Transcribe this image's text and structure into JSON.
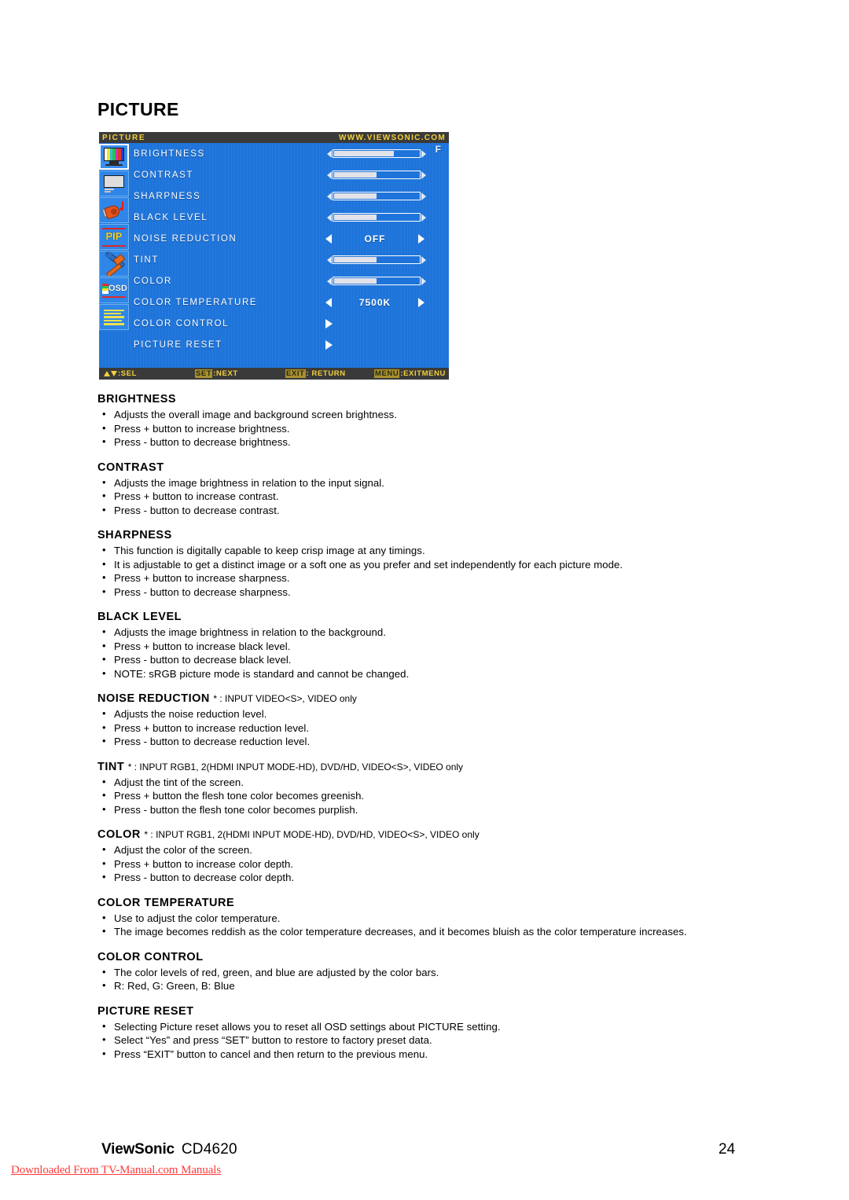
{
  "page": {
    "title": "PICTURE",
    "number": "24"
  },
  "osd": {
    "header_title": "PICTURE",
    "header_url": "WWW.VIEWSONIC.COM",
    "corner_marker": "F",
    "accent_blue": "#1e74da",
    "accent_yellow": "#f3d03a",
    "sidebar_icons": [
      {
        "name": "picture-colorbars-icon",
        "selected": true
      },
      {
        "name": "screen-monitor-icon",
        "selected": false
      },
      {
        "name": "audio-speaker-icon",
        "selected": false
      },
      {
        "name": "pip-icon",
        "label": "PIP",
        "selected": false
      },
      {
        "name": "tools-icon",
        "selected": false
      },
      {
        "name": "osd-icon",
        "label": "OSD",
        "selected": false
      },
      {
        "name": "multi-display-list-icon",
        "selected": false
      }
    ],
    "rows": [
      {
        "label": "BRIGHTNESS",
        "type": "slider",
        "fill": 70
      },
      {
        "label": "CONTRAST",
        "type": "slider",
        "fill": 50
      },
      {
        "label": "SHARPNESS",
        "type": "slider",
        "fill": 50
      },
      {
        "label": "BLACK LEVEL",
        "type": "slider",
        "fill": 50
      },
      {
        "label": "NOISE REDUCTION",
        "type": "option",
        "value": "OFF"
      },
      {
        "label": "TINT",
        "type": "slider",
        "fill": 50
      },
      {
        "label": "COLOR",
        "type": "slider",
        "fill": 50
      },
      {
        "label": "COLOR TEMPERATURE",
        "type": "option",
        "value": "7500K"
      },
      {
        "label": "COLOR CONTROL",
        "type": "submenu"
      },
      {
        "label": "PICTURE RESET",
        "type": "submenu"
      }
    ],
    "footer": [
      {
        "key": "",
        "text": ":SEL",
        "arrows": true
      },
      {
        "key": "SET",
        "text": ":NEXT",
        "arrows": false
      },
      {
        "key": "EXIT",
        "text": ": RETURN",
        "arrows": false
      },
      {
        "key": "MENU",
        "text": ":EXITMENU",
        "arrows": false
      }
    ]
  },
  "sections": [
    {
      "heading": "BRIGHTNESS",
      "note": "",
      "bullets": [
        "Adjusts the overall image and background screen brightness.",
        "Press + button to increase brightness.",
        "Press - button to decrease brightness."
      ]
    },
    {
      "heading": "CONTRAST",
      "note": "",
      "bullets": [
        "Adjusts the image brightness in relation to the input signal.",
        "Press + button to increase contrast.",
        "Press - button to decrease contrast."
      ]
    },
    {
      "heading": "SHARPNESS",
      "note": "",
      "bullets": [
        "This function is digitally capable to keep crisp image at any timings.",
        "It is adjustable to get a distinct image or a soft one as you prefer and set independently for each picture mode.",
        "Press + button to increase sharpness.",
        "Press - button to decrease sharpness."
      ]
    },
    {
      "heading": "BLACK LEVEL",
      "note": "",
      "bullets": [
        "Adjusts the image brightness in relation to the background.",
        "Press + button to increase black level.",
        "Press - button to decrease black level.",
        "NOTE: sRGB picture mode is standard and cannot be changed."
      ]
    },
    {
      "heading": "NOISE REDUCTION",
      "note": "* : INPUT VIDEO<S>, VIDEO only",
      "bullets": [
        "Adjusts the noise reduction level.",
        "Press + button to increase reduction level.",
        "Press - button to decrease reduction level."
      ]
    },
    {
      "heading": "TINT",
      "note": "* : INPUT RGB1, 2(HDMI INPUT MODE-HD), DVD/HD, VIDEO<S>, VIDEO only",
      "bullets": [
        "Adjust the tint of the screen.",
        "Press + button the flesh tone color becomes greenish.",
        "Press - button the flesh tone color becomes purplish."
      ]
    },
    {
      "heading": "COLOR",
      "note": "* : INPUT RGB1, 2(HDMI INPUT MODE-HD), DVD/HD, VIDEO<S>, VIDEO only",
      "bullets": [
        "Adjust the color of the screen.",
        "Press + button to increase color depth.",
        "Press - button to decrease color depth."
      ]
    },
    {
      "heading": "COLOR TEMPERATURE",
      "note": "",
      "bullets": [
        "Use to adjust the color temperature.",
        "The image becomes reddish as the color temperature decreases, and it becomes bluish as the color temperature increases."
      ]
    },
    {
      "heading": "COLOR CONTROL",
      "note": "",
      "bullets": [
        "The color levels of red, green, and blue are adjusted by the color bars.",
        "R: Red, G: Green, B: Blue"
      ]
    },
    {
      "heading": "PICTURE RESET",
      "note": "",
      "bullets": [
        "Selecting Picture reset allows you to reset all OSD settings about PICTURE setting.",
        "Select “Yes” and press “SET” button to restore to factory preset data.",
        "Press “EXIT” button to cancel and then return to the previous menu."
      ]
    }
  ],
  "footer": {
    "brand": "ViewSonic",
    "model": "CD4620",
    "page_number": "24",
    "download_note": "Downloaded From TV-Manual.com Manuals",
    "download_note_color": "#ff3b3b"
  }
}
